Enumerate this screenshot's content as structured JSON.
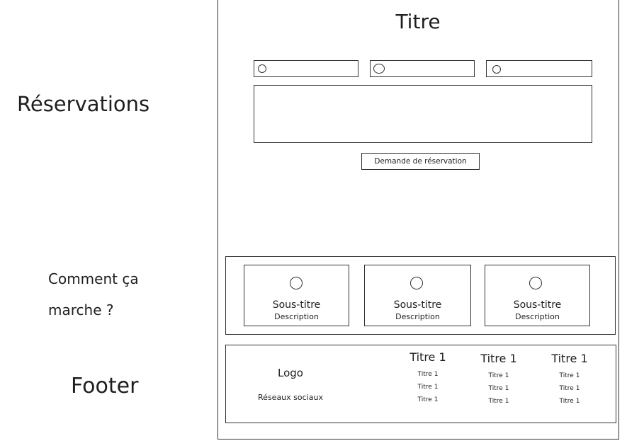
{
  "side_labels": {
    "reservations": "Réservations",
    "how_line1": "Comment ça",
    "how_line2": "marche ?",
    "footer": "Footer"
  },
  "reservation": {
    "title": "Titre",
    "button": "Demande de réservation"
  },
  "how": {
    "cards": [
      {
        "subtitle": "Sous-titre",
        "description": "Description"
      },
      {
        "subtitle": "Sous-titre",
        "description": "Description"
      },
      {
        "subtitle": "Sous-titre",
        "description": "Description"
      }
    ]
  },
  "footer": {
    "logo": "Logo",
    "social": "Réseaux sociaux",
    "columns": [
      {
        "title": "Titre 1",
        "links": [
          "Titre 1",
          "Titre 1",
          "Titre 1"
        ]
      },
      {
        "title": "Titre 1",
        "links": [
          "Titre 1",
          "Titre 1",
          "Titre 1"
        ]
      },
      {
        "title": "Titre 1",
        "links": [
          "Titre 1",
          "Titre 1",
          "Titre 1"
        ]
      }
    ]
  }
}
